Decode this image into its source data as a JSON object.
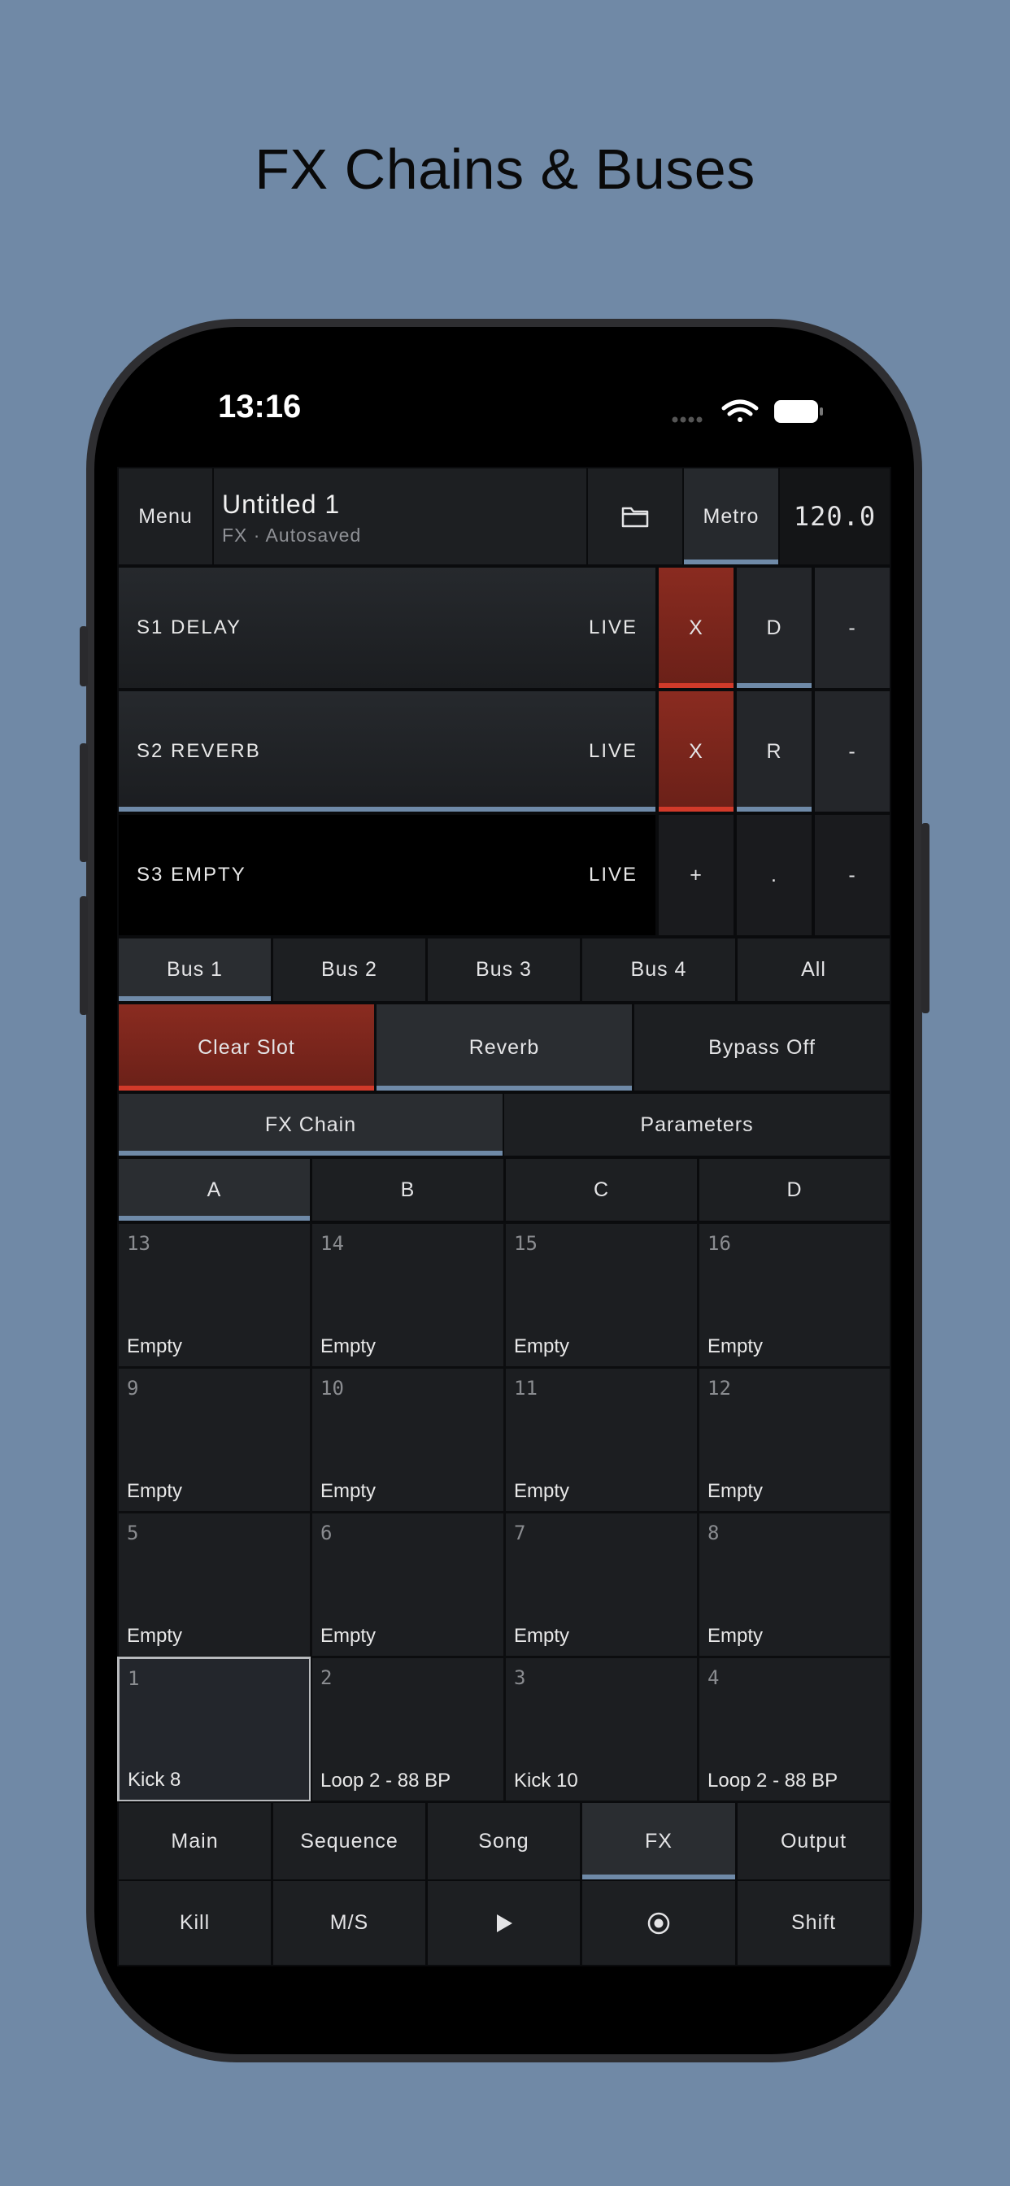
{
  "headline": "FX Chains & Buses",
  "status": {
    "time": "13:16"
  },
  "header": {
    "menu_label": "Menu",
    "project_title": "Untitled 1",
    "project_subtitle": "FX · Autosaved",
    "metro_label": "Metro",
    "tempo": "120.0"
  },
  "slots": [
    {
      "name": "S1 DELAY",
      "live": "LIVE",
      "buttons": [
        "X",
        "D",
        "-"
      ]
    },
    {
      "name": "S2 REVERB",
      "live": "LIVE",
      "buttons": [
        "X",
        "R",
        "-"
      ]
    },
    {
      "name": "S3 EMPTY",
      "live": "LIVE",
      "buttons": [
        "+",
        ".",
        "-"
      ]
    }
  ],
  "bus_tabs": [
    "Bus 1",
    "Bus 2",
    "Bus 3",
    "Bus 4",
    "All"
  ],
  "actions": [
    "Clear Slot",
    "Reverb",
    "Bypass Off"
  ],
  "view_tabs": [
    "FX Chain",
    "Parameters"
  ],
  "bank_tabs": [
    "A",
    "B",
    "C",
    "D"
  ],
  "pads": [
    {
      "num": "13",
      "label": "Empty"
    },
    {
      "num": "14",
      "label": "Empty"
    },
    {
      "num": "15",
      "label": "Empty"
    },
    {
      "num": "16",
      "label": "Empty"
    },
    {
      "num": "9",
      "label": "Empty"
    },
    {
      "num": "10",
      "label": "Empty"
    },
    {
      "num": "11",
      "label": "Empty"
    },
    {
      "num": "12",
      "label": "Empty"
    },
    {
      "num": "5",
      "label": "Empty"
    },
    {
      "num": "6",
      "label": "Empty"
    },
    {
      "num": "7",
      "label": "Empty"
    },
    {
      "num": "8",
      "label": "Empty"
    },
    {
      "num": "1",
      "label": "Kick 8"
    },
    {
      "num": "2",
      "label": "Loop 2 - 88 BP"
    },
    {
      "num": "3",
      "label": "Kick 10"
    },
    {
      "num": "4",
      "label": "Loop 2 - 88 BP"
    }
  ],
  "nav_tabs": [
    "Main",
    "Sequence",
    "Song",
    "FX",
    "Output"
  ],
  "transport": {
    "kill": "Kill",
    "ms": "M/S",
    "shift": "Shift"
  },
  "icons": [
    "wifi-icon",
    "battery-icon",
    "signal-icon",
    "folder-icon",
    "play-icon",
    "record-icon"
  ],
  "colors": {
    "background": "#7089a6",
    "accent_blue": "#6f8aa8",
    "accent_red": "#d23a2a"
  }
}
